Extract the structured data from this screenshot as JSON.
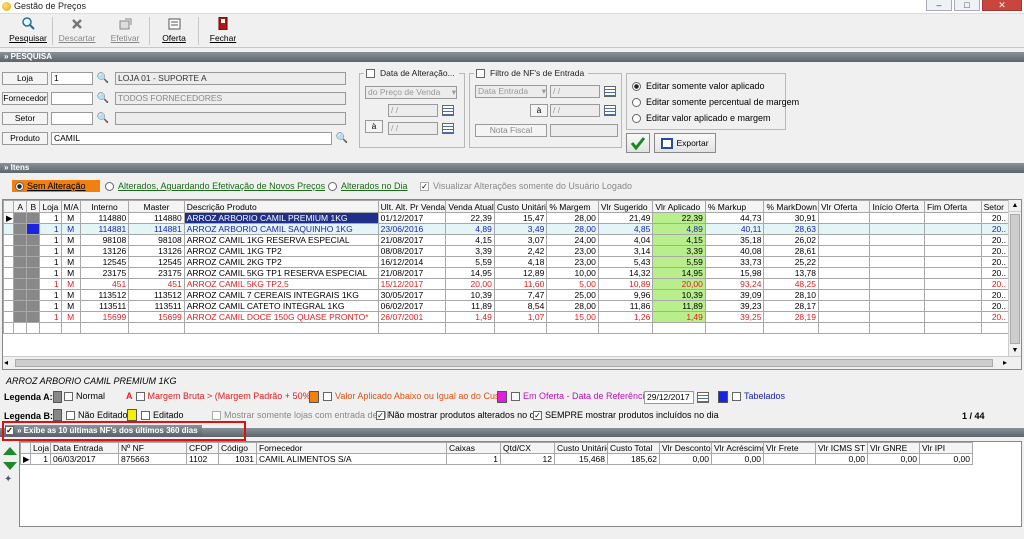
{
  "window": {
    "title": "Gestão de Preços",
    "ghost_title": "Gestão de Preços"
  },
  "toolbar": [
    {
      "label": "Pesquisar",
      "icon": "magnifier-icon",
      "enabled": true
    },
    {
      "label": "Descartar",
      "icon": "discard-icon",
      "enabled": false
    },
    {
      "label": "Efetivar",
      "icon": "apply-icon",
      "enabled": false
    },
    {
      "label": "Oferta",
      "icon": "offer-icon",
      "enabled": true
    },
    {
      "label": "Fechar",
      "icon": "close-door-icon",
      "enabled": true
    }
  ],
  "pesquisa": {
    "header": "» PESQUISA",
    "loja_label": "Loja",
    "loja_code": "1",
    "loja_name": "LOJA 01 - SUPORTE A",
    "fornecedor_label": "Fornecedor",
    "fornecedor_code": "",
    "fornecedor_name": "TODOS FORNECEDORES",
    "setor_label": "Setor",
    "setor_code": "",
    "produto_label": "Produto",
    "produto_value": "CAMIL",
    "data_alteracao": {
      "label": "Data de Alteração...",
      "checked": false,
      "select": "do Preço de Venda",
      "from": " / /",
      "a_label": "à",
      "to": " / /"
    },
    "filtro_nf": {
      "label": "Filtro de NF's de Entrada",
      "checked": false,
      "select": "Data Entrada",
      "from": " / /",
      "a_label": "à",
      "to": " / /",
      "nota_label": "Nota Fiscal",
      "nota_value": ""
    },
    "edit_modes": [
      {
        "label": "Editar somente valor aplicado",
        "selected": true
      },
      {
        "label": "Editar somente percentual de margem",
        "selected": false
      },
      {
        "label": "Editar valor aplicado e margem",
        "selected": false
      }
    ],
    "export_label": "Exportar"
  },
  "itens": {
    "header": "» Itens",
    "filters": [
      {
        "label": "Sem Alteração",
        "selected": true
      },
      {
        "label": "Alterados, Aguardando Efetivação de Novos Preços",
        "selected": false
      },
      {
        "label": "Alterados no Dia",
        "selected": false
      }
    ],
    "only_user_label": "Visualizar Alterações somente do Usuário Logado",
    "columns": [
      "A",
      "B",
      "Loja",
      "M/A",
      "Interno",
      "Master",
      "Descrição Produto",
      "Ult. Alt. Pr Venda",
      "Venda Atual",
      "Custo Unitário",
      "% Margem",
      "Vlr Sugerido",
      "Vlr Aplicado",
      "% Markup",
      "% MarkDown",
      "Vlr Oferta",
      "Início Oferta",
      "Fim Oferta",
      "Setor"
    ],
    "rows": [
      {
        "style": "sel",
        "loja": "1",
        "ma": "M",
        "interno": "114880",
        "master": "114880",
        "desc": "ARROZ ARBORIO CAMIL PREMIUM 1KG",
        "ult": "01/12/2017",
        "venda": "22,39",
        "custo": "15,47",
        "margem": "28,00",
        "sug": "21,49",
        "apl": "22,39",
        "markup": "44,73",
        "markdown": "30,91",
        "setor": "20.."
      },
      {
        "style": "blue",
        "loja": "1",
        "ma": "M",
        "interno": "114881",
        "master": "114881",
        "desc": "ARROZ ARBORIO CAMIL SAQUINHO 1KG",
        "ult": "23/06/2016",
        "venda": "4,89",
        "custo": "3,49",
        "margem": "28,00",
        "sug": "4,85",
        "apl": "4,89",
        "markup": "40,11",
        "markdown": "28,63",
        "setor": "20.."
      },
      {
        "style": "",
        "loja": "1",
        "ma": "M",
        "interno": "98108",
        "master": "98108",
        "desc": "ARROZ CAMIL 1KG RESERVA ESPECIAL",
        "ult": "21/08/2017",
        "venda": "4,15",
        "custo": "3,07",
        "margem": "24,00",
        "sug": "4,04",
        "apl": "4,15",
        "markup": "35,18",
        "markdown": "26,02",
        "setor": "20.."
      },
      {
        "style": "",
        "loja": "1",
        "ma": "M",
        "interno": "13126",
        "master": "13126",
        "desc": "ARROZ CAMIL 1KG TP2",
        "ult": "08/08/2017",
        "venda": "3,39",
        "custo": "2,42",
        "margem": "23,00",
        "sug": "3,14",
        "apl": "3,39",
        "markup": "40,08",
        "markdown": "28,61",
        "setor": "20.."
      },
      {
        "style": "",
        "loja": "1",
        "ma": "M",
        "interno": "12545",
        "master": "12545",
        "desc": "ARROZ CAMIL 2KG TP2",
        "ult": "16/12/2014",
        "venda": "5,59",
        "custo": "4,18",
        "margem": "23,00",
        "sug": "5,43",
        "apl": "5,59",
        "markup": "33,73",
        "markdown": "25,22",
        "setor": "20.."
      },
      {
        "style": "",
        "loja": "1",
        "ma": "M",
        "interno": "23175",
        "master": "23175",
        "desc": "ARROZ CAMIL 5KG TP1 RESERVA ESPECIAL",
        "ult": "21/08/2017",
        "venda": "14,95",
        "custo": "12,89",
        "margem": "10,00",
        "sug": "14,32",
        "apl": "14,95",
        "markup": "15,98",
        "markdown": "13,78",
        "setor": "20.."
      },
      {
        "style": "red",
        "loja": "1",
        "ma": "M",
        "interno": "451",
        "master": "451",
        "desc": "ARROZ CAMIL 5KG TP2,5",
        "ult": "15/12/2017",
        "venda": "20,00",
        "custo": "11,60",
        "margem": "5,00",
        "sug": "10,89",
        "apl": "20,00",
        "markup": "93,24",
        "markdown": "48,25",
        "setor": "20.."
      },
      {
        "style": "",
        "loja": "1",
        "ma": "M",
        "interno": "113512",
        "master": "113512",
        "desc": "ARROZ CAMIL 7 CEREAIS INTEGRAIS 1KG",
        "ult": "30/05/2017",
        "venda": "10,39",
        "custo": "7,47",
        "margem": "25,00",
        "sug": "9,96",
        "apl": "10,39",
        "markup": "39,09",
        "markdown": "28,10",
        "setor": "20.."
      },
      {
        "style": "",
        "loja": "1",
        "ma": "M",
        "interno": "113511",
        "master": "113511",
        "desc": "ARROZ CAMIL CATETO INTEGRAL 1KG",
        "ult": "06/02/2017",
        "venda": "11,89",
        "custo": "8,54",
        "margem": "28,00",
        "sug": "11,86",
        "apl": "11,89",
        "markup": "39,23",
        "markdown": "28,17",
        "setor": "20.."
      },
      {
        "style": "red",
        "loja": "1",
        "ma": "M",
        "interno": "15699",
        "master": "15699",
        "desc": "ARROZ CAMIL DOCE 150G QUASE PRONTO*",
        "ult": "26/07/2001",
        "venda": "1,49",
        "custo": "1,07",
        "margem": "15,00",
        "sug": "1,26",
        "apl": "1,49",
        "markup": "39,25",
        "markdown": "28,19",
        "setor": "20.."
      }
    ],
    "selected_desc": "ARROZ ARBORIO CAMIL PREMIUM 1KG"
  },
  "legend": {
    "a_label": "Legenda A:",
    "a_items": [
      {
        "text": "Normal",
        "color": "#ffffff"
      },
      {
        "text": "Margem Bruta > (Margem Padrão + 50%)",
        "color": "#e02020",
        "prefix": "A"
      },
      {
        "text": "Valor Aplicado Abaixo ou Igual ao do Custo",
        "color": "#f08010"
      },
      {
        "text": "Em Oferta - Data de Referência",
        "color": "#e020e0",
        "date": "29/12/2017"
      },
      {
        "text": "Tabelados",
        "color": "#1a24e0"
      }
    ],
    "b_label": "Legenda B:",
    "b_items": [
      {
        "text": "Não Editado",
        "color": "#ffffff"
      },
      {
        "text": "Editado",
        "color": "#f8f000"
      }
    ],
    "opt1": "Mostrar somente lojas com entrada de NF",
    "opt2": "Não mostrar produtos alterados no dia",
    "opt3": "SEMPRE mostrar produtos incluídos no dia",
    "page": "1 / 44"
  },
  "nf": {
    "header": "» Exibe as 10 últimas NF's dos últimos 360 dias",
    "columns": [
      "Loja",
      "Data Entrada",
      "Nº NF",
      "CFOP",
      "Código",
      "Fornecedor",
      "Caixas",
      "Qtd/CX",
      "Custo Unitário",
      "Custo Total",
      "Vlr Desconto",
      "Vlr Acréscimo",
      "Vlr Frete",
      "Vlr ICMS ST",
      "Vlr GNRE",
      "Vlr IPI"
    ],
    "rows": [
      {
        "loja": "1",
        "data": "06/03/2017",
        "nf": "875663",
        "cfop": "1102",
        "codigo": "1031",
        "fornecedor": "CAMIL ALIMENTOS S/A",
        "caixas": "1",
        "qtd": "12",
        "cu": "15,468",
        "ct": "185,62",
        "desc": "0,00",
        "acr": "0,00",
        "frete": "",
        "icms": "0,00",
        "gnre": "0,00",
        "ipi": "0,00"
      }
    ]
  }
}
